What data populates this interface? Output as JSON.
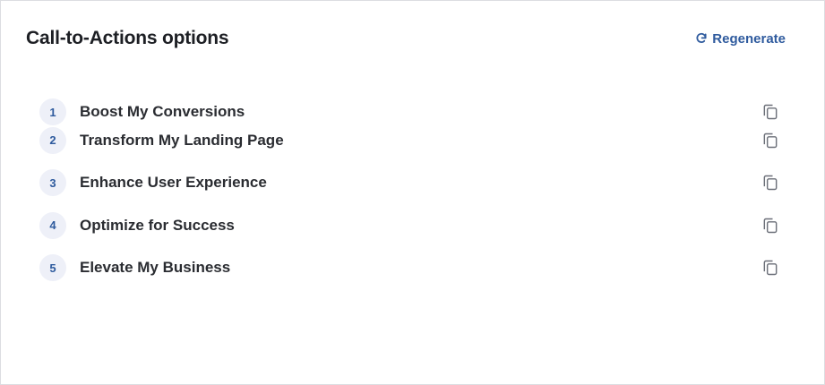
{
  "panel": {
    "title": "Call-to-Actions options",
    "regenerate_label": "Regenerate"
  },
  "colors": {
    "accent": "#2f5b9e",
    "icon": "#6b6f78"
  },
  "options": [
    {
      "number": "1",
      "label": "Boost My Conversions"
    },
    {
      "number": "2",
      "label": "Transform My Landing Page"
    },
    {
      "number": "3",
      "label": "Enhance User Experience"
    },
    {
      "number": "4",
      "label": "Optimize for Success"
    },
    {
      "number": "5",
      "label": "Elevate My Business"
    }
  ],
  "icons": {
    "regenerate": "refresh-icon",
    "copy": "copy-icon"
  }
}
